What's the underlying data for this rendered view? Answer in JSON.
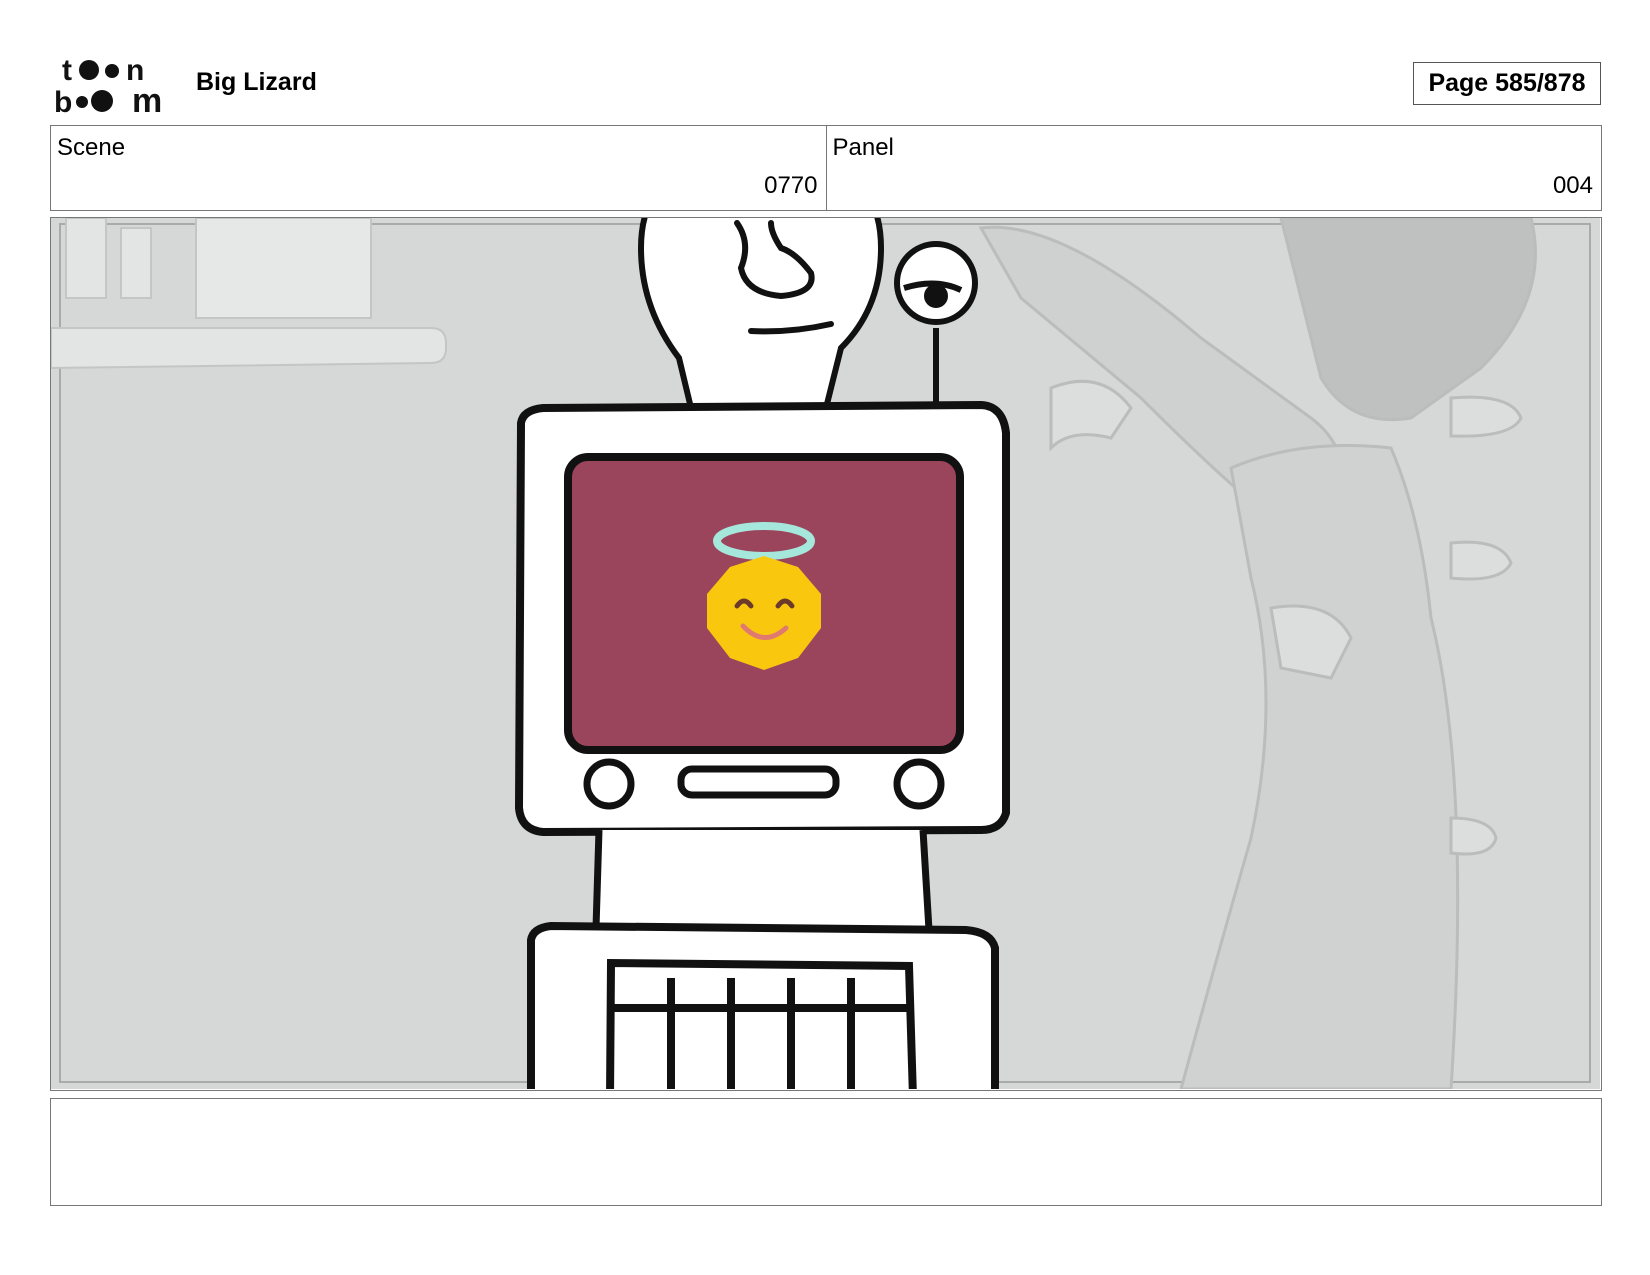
{
  "header": {
    "logo_line_1": "toon",
    "logo_line_2": "boom",
    "project_title": "Big Lizard",
    "page_label": "Page 585/878"
  },
  "info": {
    "scene_label": "Scene",
    "scene_value": "0770",
    "panel_label": "Panel",
    "panel_value": "004"
  },
  "notes": {
    "text": ""
  },
  "colors": {
    "background_gray": "#d6d7d7",
    "screen": "#9b455c",
    "face": "#f9c80e",
    "halo": "#a6e7dc",
    "smile": "#e07a6f"
  }
}
